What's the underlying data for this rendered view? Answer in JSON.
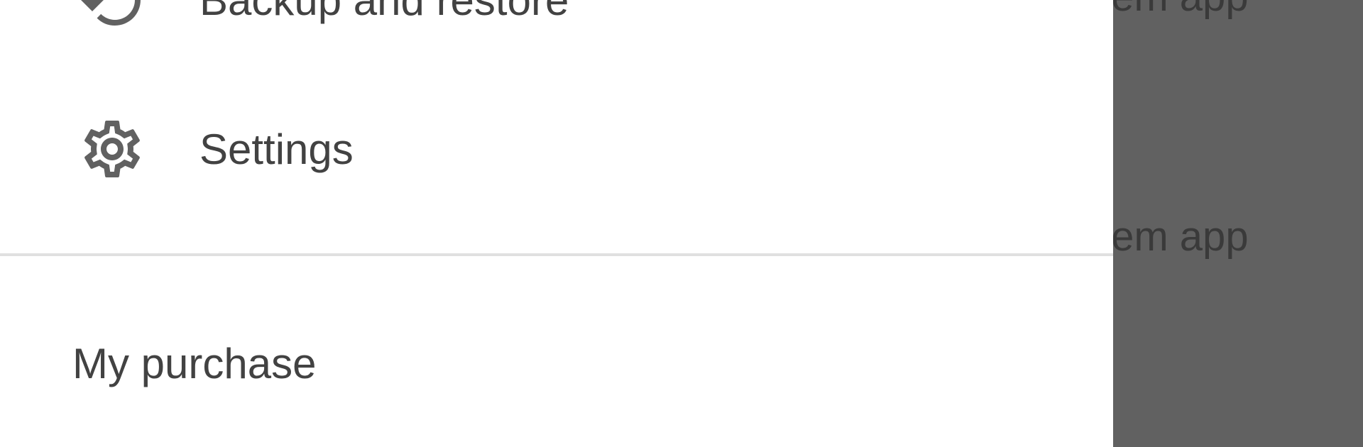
{
  "background_app": {
    "row_texts": [
      "stem app",
      "stem app"
    ]
  },
  "drawer": {
    "items": [
      {
        "label": "Backup and restore",
        "icon": "restore-icon"
      },
      {
        "label": "Settings",
        "icon": "gear-icon"
      }
    ],
    "section_header": "My purchase"
  },
  "colors": {
    "drawer_bg": "#ffffff",
    "scrim": "#616161",
    "text": "#424242",
    "icon": "#616161",
    "divider": "#e0e0e0"
  }
}
